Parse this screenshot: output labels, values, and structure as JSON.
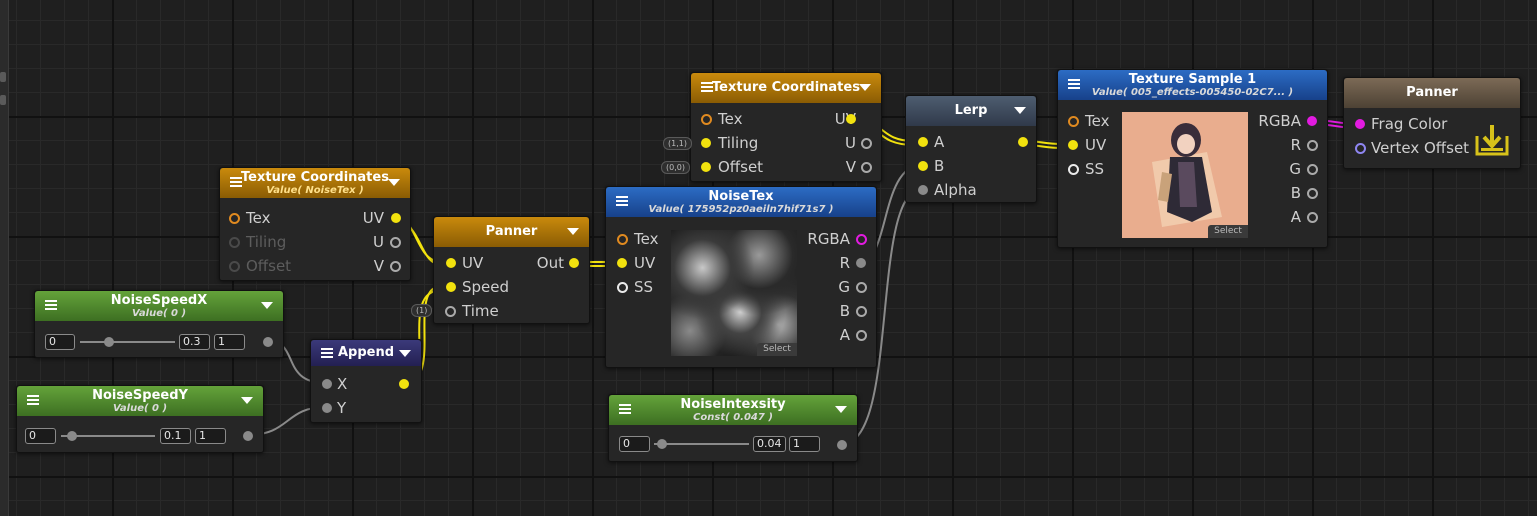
{
  "colors": {
    "wire_yellow": "#f2e20e",
    "wire_gray": "#8a8a8a",
    "wire_magenta": "#e21be0"
  },
  "nodes": {
    "texcoord_noise": {
      "title": "Texture Coordinates",
      "subtitle": "Value( NoiseTex )",
      "ports": {
        "tex": "Tex",
        "tiling": "Tiling",
        "offset": "Offset",
        "uv": "UV",
        "u": "U",
        "v": "V"
      }
    },
    "noise_speed_x": {
      "title": "NoiseSpeedX",
      "subtitle": "Value( 0 )",
      "min": "0",
      "value": "0.3",
      "max": "1"
    },
    "noise_speed_y": {
      "title": "NoiseSpeedY",
      "subtitle": "Value( 0 )",
      "min": "0",
      "value": "0.1",
      "max": "1"
    },
    "append": {
      "title": "Append",
      "ports": {
        "x": "X",
        "y": "Y"
      }
    },
    "panner_mid": {
      "title": "Panner",
      "ports": {
        "uv": "UV",
        "speed": "Speed",
        "time": "Time",
        "out": "Out"
      },
      "time_pill": "(1)"
    },
    "texcoord_top": {
      "title": "Texture Coordinates",
      "ports": {
        "tex": "Tex",
        "tiling": "Tiling",
        "offset": "Offset",
        "uv": "UV",
        "u": "U",
        "v": "V"
      },
      "tiling_pill": "(1,1)",
      "offset_pill": "(0,0)"
    },
    "noisetex": {
      "title": "NoiseTex",
      "subtitle": "Value( 175952pz0aeiln7hif71s7 )",
      "ports": {
        "tex": "Tex",
        "uv": "UV",
        "ss": "SS",
        "rgba": "RGBA",
        "r": "R",
        "g": "G",
        "b": "B",
        "a": "A"
      },
      "select": "Select"
    },
    "noise_intensity": {
      "title": "NoiseIntexsity",
      "subtitle": "Const( 0.047 )",
      "min": "0",
      "value": "0.04",
      "max": "1"
    },
    "lerp": {
      "title": "Lerp",
      "ports": {
        "a": "A",
        "b": "B",
        "alpha": "Alpha"
      }
    },
    "texsample1": {
      "title": "Texture Sample 1",
      "subtitle": "Value( 005_effects-005450-02C7... )",
      "ports": {
        "tex": "Tex",
        "uv": "UV",
        "ss": "SS",
        "rgba": "RGBA",
        "r": "R",
        "g": "G",
        "b": "B",
        "a": "A"
      },
      "select": "Select"
    },
    "output": {
      "title": "Panner",
      "ports": {
        "frag_color": "Frag Color",
        "vertex_offset": "Vertex Offset"
      }
    }
  }
}
